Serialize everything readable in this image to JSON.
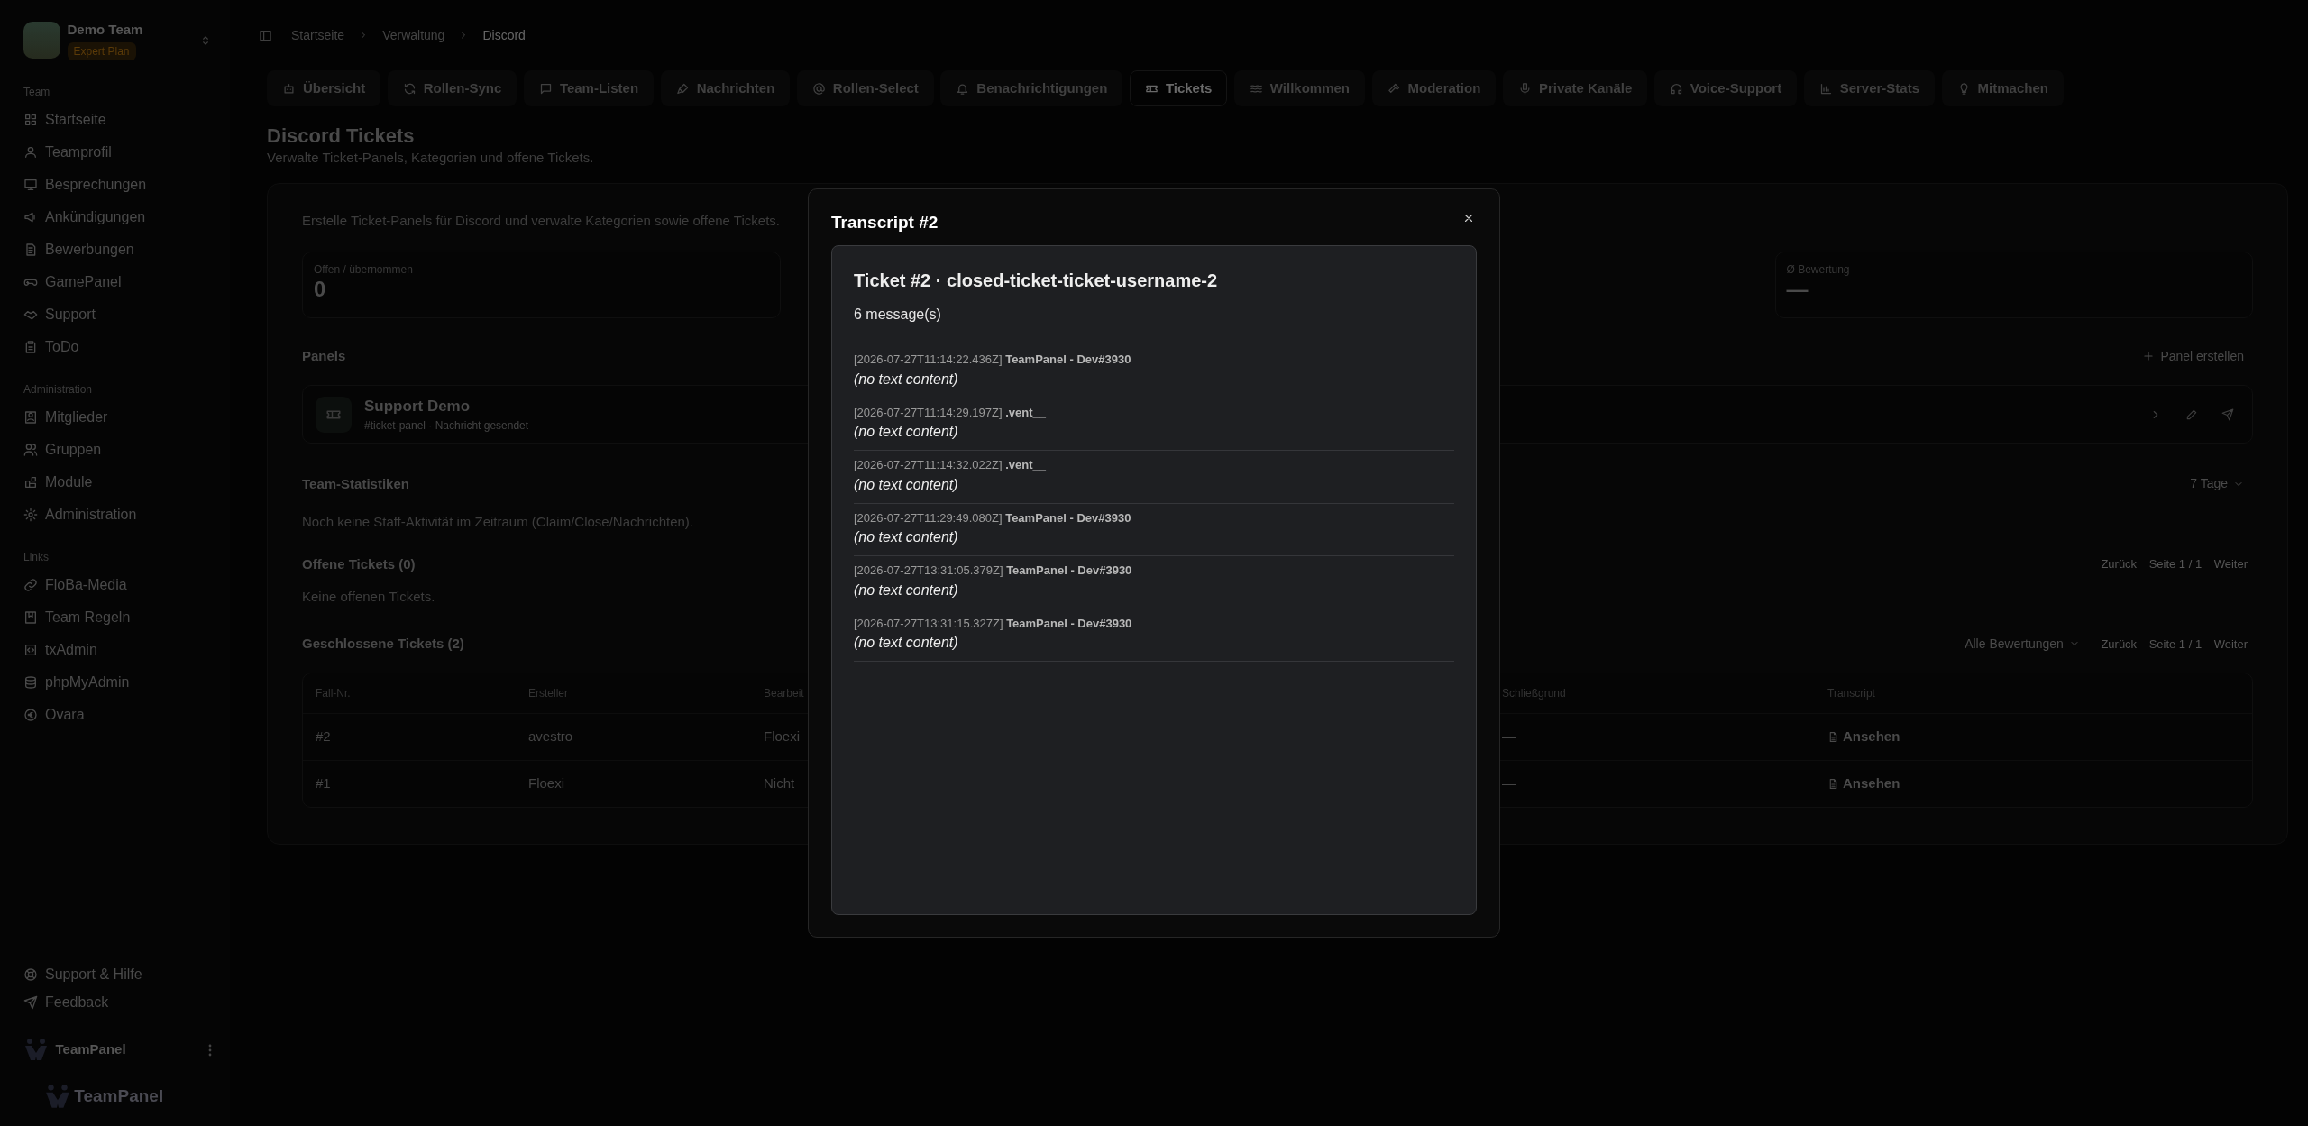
{
  "sidebar": {
    "team": {
      "name": "Demo Team",
      "plan": "Expert Plan"
    },
    "sections": [
      {
        "title": "Team",
        "items": [
          {
            "label": "Startseite"
          },
          {
            "label": "Teamprofil"
          },
          {
            "label": "Besprechungen"
          },
          {
            "label": "Ankündigungen"
          },
          {
            "label": "Bewerbungen"
          },
          {
            "label": "GamePanel"
          },
          {
            "label": "Support"
          },
          {
            "label": "ToDo"
          }
        ]
      },
      {
        "title": "Administration",
        "items": [
          {
            "label": "Mitglieder"
          },
          {
            "label": "Gruppen"
          },
          {
            "label": "Module"
          },
          {
            "label": "Administration"
          }
        ]
      },
      {
        "title": "Links",
        "items": [
          {
            "label": "FloBa-Media"
          },
          {
            "label": "Team Regeln"
          },
          {
            "label": "txAdmin"
          },
          {
            "label": "phpMyAdmin"
          },
          {
            "label": "Ovara"
          }
        ]
      }
    ],
    "footer_items": [
      {
        "label": "Support & Hilfe"
      },
      {
        "label": "Feedback"
      }
    ],
    "user": {
      "name": "TeamPanel"
    },
    "brand": "TeamPanel"
  },
  "breadcrumb": [
    "Startseite",
    "Verwaltung",
    "Discord"
  ],
  "tabs": [
    {
      "label": "Übersicht",
      "selected": false
    },
    {
      "label": "Rollen-Sync",
      "selected": false
    },
    {
      "label": "Team-Listen",
      "selected": false
    },
    {
      "label": "Nachrichten",
      "selected": false
    },
    {
      "label": "Rollen-Select",
      "selected": false
    },
    {
      "label": "Benachrichtigungen",
      "selected": false
    },
    {
      "label": "Tickets",
      "selected": true
    },
    {
      "label": "Willkommen",
      "selected": false
    },
    {
      "label": "Moderation",
      "selected": false
    },
    {
      "label": "Private Kanäle",
      "selected": false
    },
    {
      "label": "Voice-Support",
      "selected": false
    },
    {
      "label": "Server-Stats",
      "selected": false
    },
    {
      "label": "Mitmachen",
      "selected": false
    }
  ],
  "page": {
    "title": "Discord Tickets",
    "subtitle": "Verwalte Ticket-Panels, Kategorien und offene Tickets."
  },
  "card": {
    "intro": "Erstelle Ticket-Panels für Discord und verwalte Kategorien sowie offene Tickets.",
    "stats": [
      {
        "label": "Offen / übernommen",
        "value": "0"
      },
      {
        "label": "Ø Bewertung",
        "value": "—"
      }
    ],
    "panels": {
      "title": "Panels",
      "button": "Panel erstellen",
      "items": [
        {
          "name": "Support Demo",
          "meta": "#ticket-panel · Nachricht gesendet"
        }
      ]
    },
    "team_stats": {
      "title": "Team-Statistiken",
      "range": "7 Tage",
      "empty": "Noch keine Staff-Aktivität im Zeitraum (Claim/Close/Nachrichten)."
    },
    "open_tickets": {
      "title": "Offene Tickets (0)",
      "empty": "Keine offenen Tickets.",
      "pager": {
        "prev": "Zurück",
        "page": "Seite 1 / 1",
        "next": "Weiter"
      }
    },
    "closed_tickets": {
      "title": "Geschlossene Tickets (2)",
      "filter": "Alle Bewertungen",
      "pager": {
        "prev": "Zurück",
        "page": "Seite 1 / 1",
        "next": "Weiter"
      },
      "table": {
        "columns": [
          "Fall-Nr.",
          "Ersteller",
          "Bearbeit",
          "Schließgrund",
          "Transcript"
        ],
        "rows": [
          {
            "cells": [
              "#2",
              "avestro",
              "Floexi",
              "—"
            ],
            "action": "Ansehen"
          },
          {
            "cells": [
              "#1",
              "Floexi",
              "Nicht",
              "—"
            ],
            "action": "Ansehen"
          }
        ]
      }
    }
  },
  "modal": {
    "title": "Transcript #2",
    "transcript": {
      "heading": "Ticket #2 · closed-ticket-ticket-username-2",
      "count": "6 message(s)",
      "messages": [
        {
          "time": "[2026-07-27T11:14:22.436Z]",
          "author": "TeamPanel - Dev#3930",
          "content": "(no text content)"
        },
        {
          "time": "[2026-07-27T11:14:29.197Z]",
          "author": ".vent__",
          "content": "(no text content)"
        },
        {
          "time": "[2026-07-27T11:14:32.022Z]",
          "author": ".vent__",
          "content": "(no text content)"
        },
        {
          "time": "[2026-07-27T11:29:49.080Z]",
          "author": "TeamPanel - Dev#3930",
          "content": "(no text content)"
        },
        {
          "time": "[2026-07-27T13:31:05.379Z]",
          "author": "TeamPanel - Dev#3930",
          "content": "(no text content)"
        },
        {
          "time": "[2026-07-27T13:31:15.327Z]",
          "author": "TeamPanel - Dev#3930",
          "content": "(no text content)"
        }
      ]
    }
  }
}
